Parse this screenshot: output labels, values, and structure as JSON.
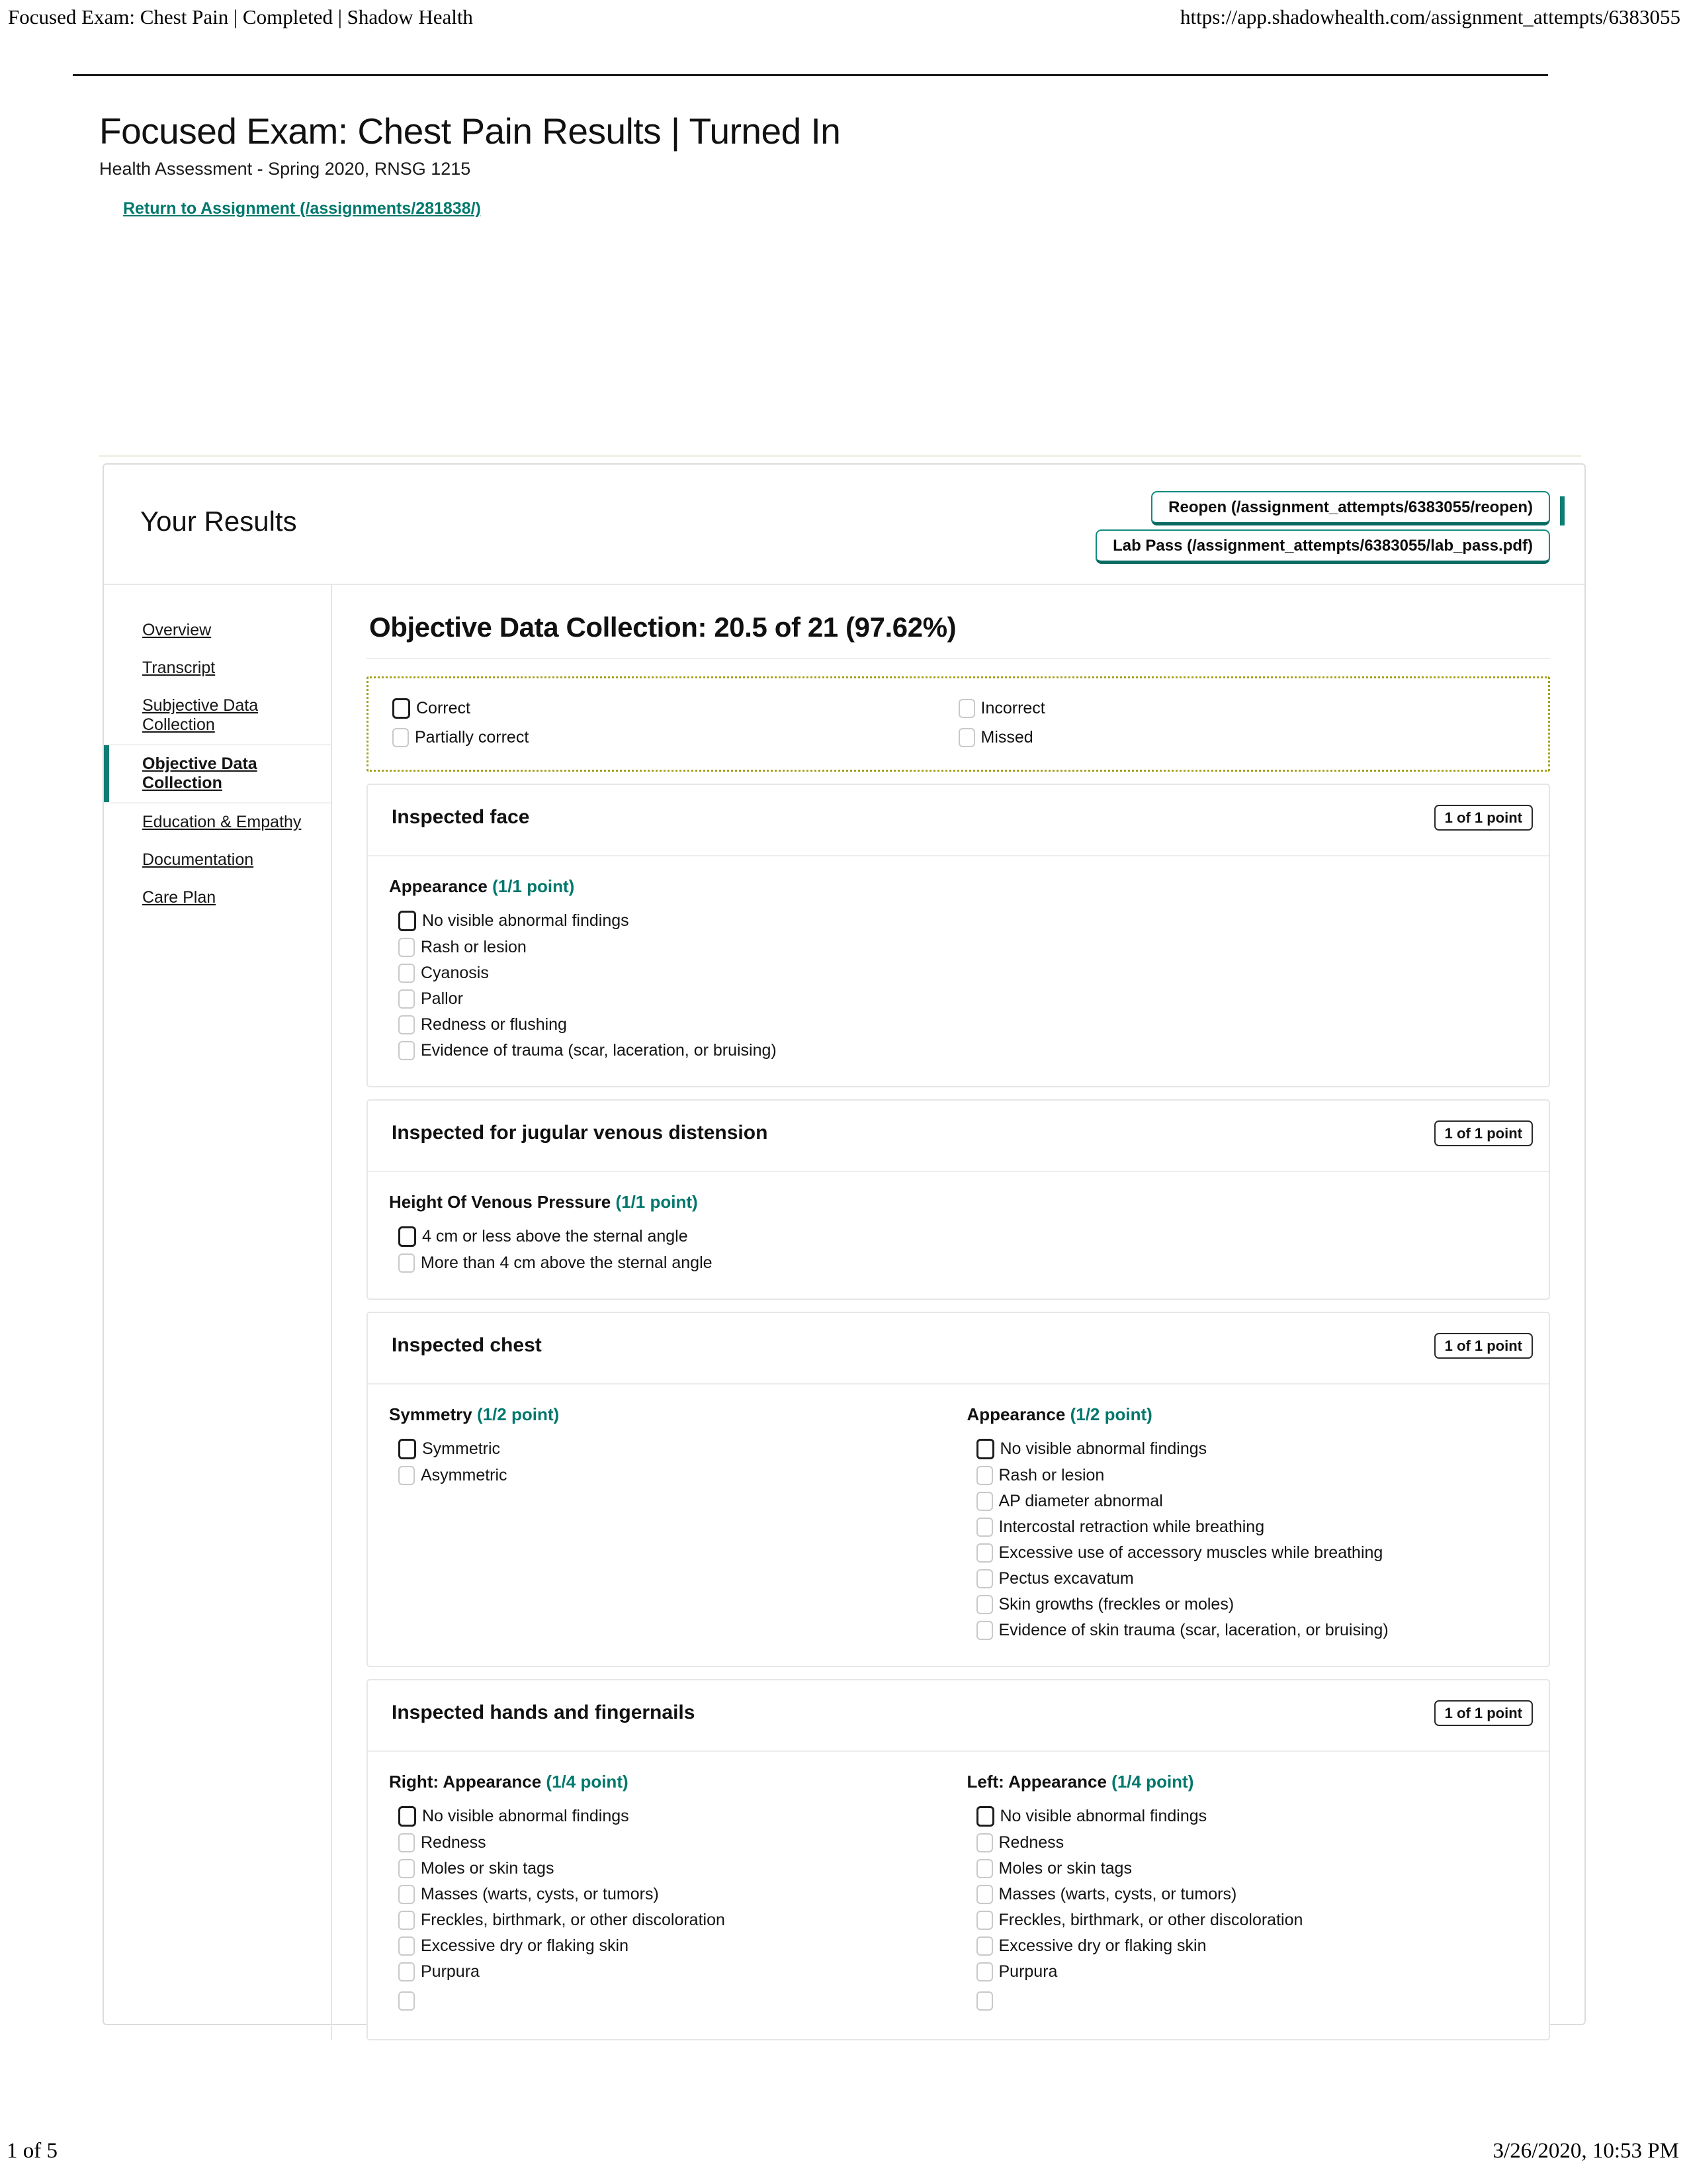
{
  "print_header": {
    "left": "Focused Exam: Chest Pain | Completed | Shadow Health",
    "right": "https://app.shadowhealth.com/assignment_attempts/6383055"
  },
  "print_footer": {
    "left": "1 of 5",
    "right": "3/26/2020, 10:53 PM"
  },
  "page": {
    "title": "Focused Exam: Chest Pain Results | Turned In",
    "subtitle": "Health Assessment - Spring 2020, RNSG 1215",
    "return_link": "Return to Assignment (/assignments/281838/)"
  },
  "panel": {
    "title": "Your Results",
    "reopen_button": "Reopen (/assignment_attempts/6383055/reopen)",
    "lab_pass_button": "Lab Pass (/assignment_attempts/6383055/lab_pass.pdf)"
  },
  "sidebar": {
    "items": [
      {
        "label": "Overview",
        "active": false
      },
      {
        "label": "Transcript",
        "active": false
      },
      {
        "label": "Subjective Data Collection",
        "active": false
      },
      {
        "label": "Objective Data Collection",
        "active": true
      },
      {
        "label": "Education & Empathy",
        "active": false
      },
      {
        "label": "Documentation",
        "active": false
      },
      {
        "label": "Care Plan",
        "active": false
      }
    ]
  },
  "objective": {
    "heading": "Objective Data Collection: 20.5 of 21 (97.62%)",
    "legend": [
      {
        "label": "Correct",
        "state": "correct"
      },
      {
        "label": "Incorrect",
        "state": "plain"
      },
      {
        "label": "Partially correct",
        "state": "plain"
      },
      {
        "label": "Missed",
        "state": "plain"
      }
    ],
    "accent_teal": "#00786d",
    "legend_border": "#a3a11c",
    "sections": [
      {
        "name": "Inspected face",
        "badge": "1 of 1 point",
        "groups": [
          {
            "title": "Appearance",
            "points": "(1/1 point)",
            "options": [
              {
                "label": "No visible abnormal findings",
                "state": "correct"
              },
              {
                "label": "Rash or lesion",
                "state": "plain"
              },
              {
                "label": "Cyanosis",
                "state": "plain"
              },
              {
                "label": "Pallor",
                "state": "plain"
              },
              {
                "label": "Redness or flushing",
                "state": "plain"
              },
              {
                "label": "Evidence of trauma (scar, laceration, or bruising)",
                "state": "plain"
              }
            ]
          }
        ]
      },
      {
        "name": "Inspected for jugular venous distension",
        "badge": "1 of 1 point",
        "groups": [
          {
            "title": "Height Of Venous Pressure",
            "points": "(1/1 point)",
            "options": [
              {
                "label": "4 cm or less above the sternal angle",
                "state": "correct"
              },
              {
                "label": "More than 4 cm above the sternal angle",
                "state": "plain"
              }
            ]
          }
        ]
      },
      {
        "name": "Inspected chest",
        "badge": "1 of 1 point",
        "groups": [
          {
            "title": "Symmetry",
            "points": "(1/2 point)",
            "options": [
              {
                "label": "Symmetric",
                "state": "correct"
              },
              {
                "label": "Asymmetric",
                "state": "plain"
              }
            ]
          },
          {
            "title": "Appearance",
            "points": "(1/2 point)",
            "options": [
              {
                "label": "No visible abnormal findings",
                "state": "correct"
              },
              {
                "label": "Rash or lesion",
                "state": "plain"
              },
              {
                "label": "AP diameter abnormal",
                "state": "plain"
              },
              {
                "label": "Intercostal retraction while breathing",
                "state": "plain"
              },
              {
                "label": "Excessive use of accessory muscles while breathing",
                "state": "plain"
              },
              {
                "label": "Pectus excavatum",
                "state": "plain"
              },
              {
                "label": "Skin growths (freckles or moles)",
                "state": "plain"
              },
              {
                "label": "Evidence of skin trauma (scar, laceration, or bruising)",
                "state": "plain"
              }
            ]
          }
        ]
      },
      {
        "name": "Inspected hands and fingernails",
        "badge": "1 of 1 point",
        "groups": [
          {
            "title": "Right: Appearance",
            "points": "(1/4 point)",
            "options": [
              {
                "label": "No visible abnormal findings",
                "state": "correct"
              },
              {
                "label": "Redness",
                "state": "plain"
              },
              {
                "label": "Moles or skin tags",
                "state": "plain"
              },
              {
                "label": "Masses (warts, cysts, or tumors)",
                "state": "plain"
              },
              {
                "label": "Freckles, birthmark, or other discoloration",
                "state": "plain"
              },
              {
                "label": "Excessive dry or flaking skin",
                "state": "plain"
              },
              {
                "label": "Purpura",
                "state": "plain"
              },
              {
                "label": "",
                "state": "plain"
              }
            ]
          },
          {
            "title": "Left: Appearance",
            "points": "(1/4 point)",
            "options": [
              {
                "label": "No visible abnormal findings",
                "state": "correct"
              },
              {
                "label": "Redness",
                "state": "plain"
              },
              {
                "label": "Moles or skin tags",
                "state": "plain"
              },
              {
                "label": "Masses (warts, cysts, or tumors)",
                "state": "plain"
              },
              {
                "label": "Freckles, birthmark, or other discoloration",
                "state": "plain"
              },
              {
                "label": "Excessive dry or flaking skin",
                "state": "plain"
              },
              {
                "label": "Purpura",
                "state": "plain"
              },
              {
                "label": "",
                "state": "plain"
              }
            ]
          }
        ]
      }
    ]
  }
}
